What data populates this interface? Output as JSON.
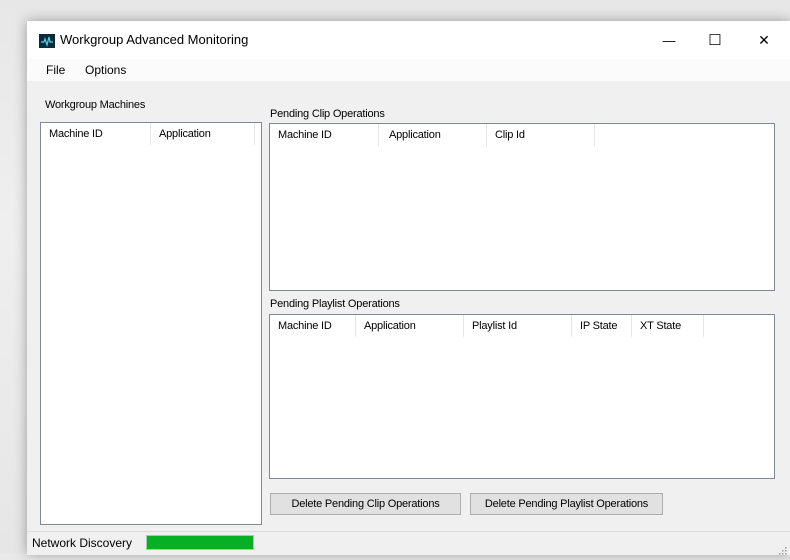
{
  "window": {
    "title": "Workgroup Advanced Monitoring",
    "minimize_symbol": "—",
    "maximize_symbol": "☐",
    "close_symbol": "✕",
    "icon": "app-monitor-icon"
  },
  "menu": {
    "items": [
      "File",
      "Options"
    ]
  },
  "workgroup_machines": {
    "label": "Workgroup Machines",
    "columns": [
      "Machine ID",
      "Application"
    ],
    "rows": []
  },
  "pending_clip_operations": {
    "label": "Pending Clip Operations",
    "columns": [
      "Machine ID",
      "Application",
      "Clip Id"
    ],
    "rows": []
  },
  "pending_playlist_operations": {
    "label": "Pending Playlist Operations",
    "columns": [
      "Machine ID",
      "Application",
      "Playlist Id",
      "IP State",
      "XT State"
    ],
    "rows": []
  },
  "buttons": {
    "delete_clip": "Delete Pending Clip Operations",
    "delete_playlist": "Delete Pending Playlist Operations"
  },
  "status": {
    "text": "Network Discovery",
    "progress_percent": 100,
    "progress_color": "#06b025"
  }
}
